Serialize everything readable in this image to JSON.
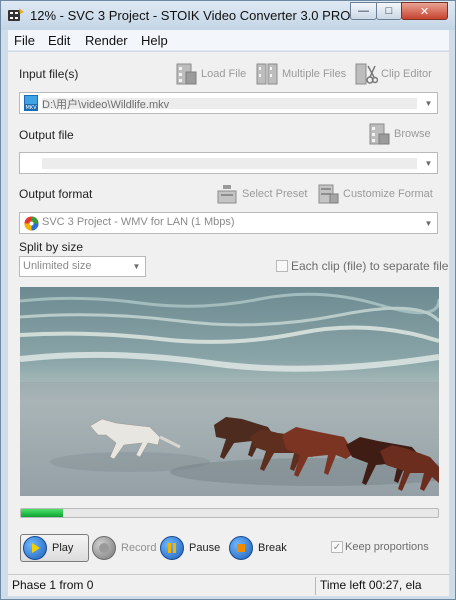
{
  "window": {
    "title": "12% - SVC 3 Project - STOIK Video Converter 3.0 PRO"
  },
  "menu": [
    "File",
    "Edit",
    "Render",
    "Help"
  ],
  "input": {
    "label": "Input file(s)",
    "load_file": "Load File",
    "multiple_files": "Multiple Files",
    "clip_editor": "Clip Editor",
    "file_badge": "MKV",
    "path": "D:\\用户\\video\\Wildlife.mkv"
  },
  "output": {
    "label": "Output file",
    "browse": "Browse",
    "path": ""
  },
  "format": {
    "label": "Output format",
    "select_preset": "Select Preset",
    "customize_format": "Customize Format",
    "value": "SVC 3 Project - WMV for LAN (1 Mbps)"
  },
  "split": {
    "label": "Split by size",
    "value": "Unlimited size",
    "each_clip_label": "Each clip (file) to separate file",
    "each_clip_checked": false
  },
  "progress": {
    "value": 0.1,
    "color": "#1bb13c"
  },
  "controls": {
    "play": "Play",
    "record": "Record",
    "pause": "Pause",
    "break": "Break",
    "keep_proportions": "Keep proportions",
    "keep_proportions_checked": true
  },
  "status": {
    "phase": "Phase 1 from 0",
    "time": "Time left 00:27, ela"
  },
  "colors": {
    "accent": "#2b6fd6",
    "pause": "#f3b400",
    "break": "#f08a00"
  }
}
